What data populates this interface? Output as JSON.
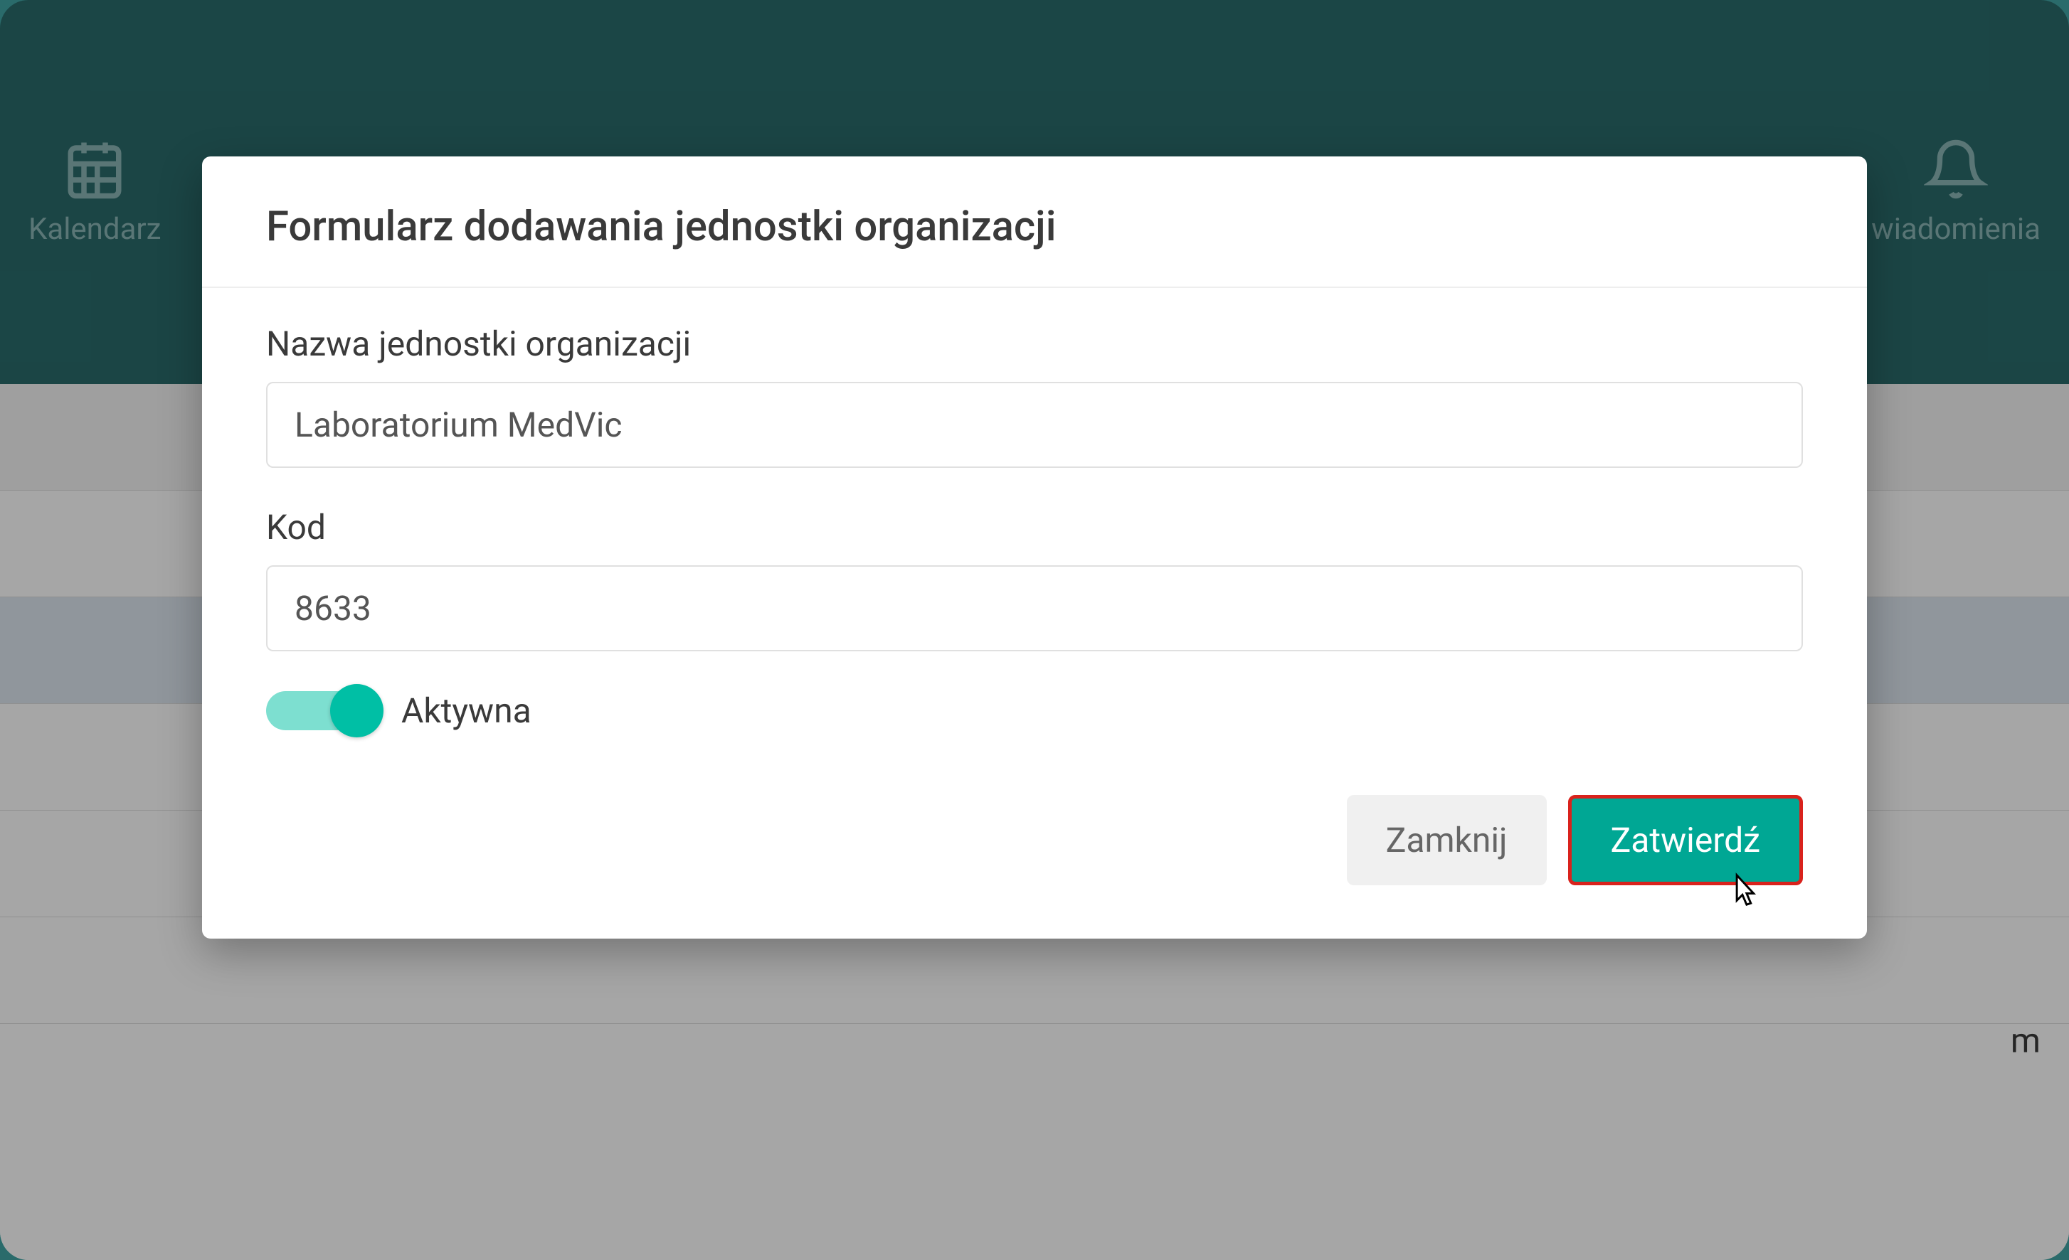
{
  "nav": {
    "calendar": "Kalendarz",
    "notifications": "wiadomienia"
  },
  "modal": {
    "title": "Formularz dodawania jednostki organizacji",
    "name_label": "Nazwa jednostki organizacji",
    "name_value": "Laboratorium MedVic",
    "code_label": "Kod",
    "code_value": "8633",
    "active_label": "Aktywna",
    "close_btn": "Zamknij",
    "confirm_btn": "Zatwierdź"
  },
  "background": {
    "partial_text": "m"
  },
  "colors": {
    "header_bg": "#2a6b6b",
    "primary": "#00a794",
    "toggle_track": "#7ddfd0",
    "toggle_knob": "#00bfa5",
    "highlight_border": "#d9221c"
  }
}
